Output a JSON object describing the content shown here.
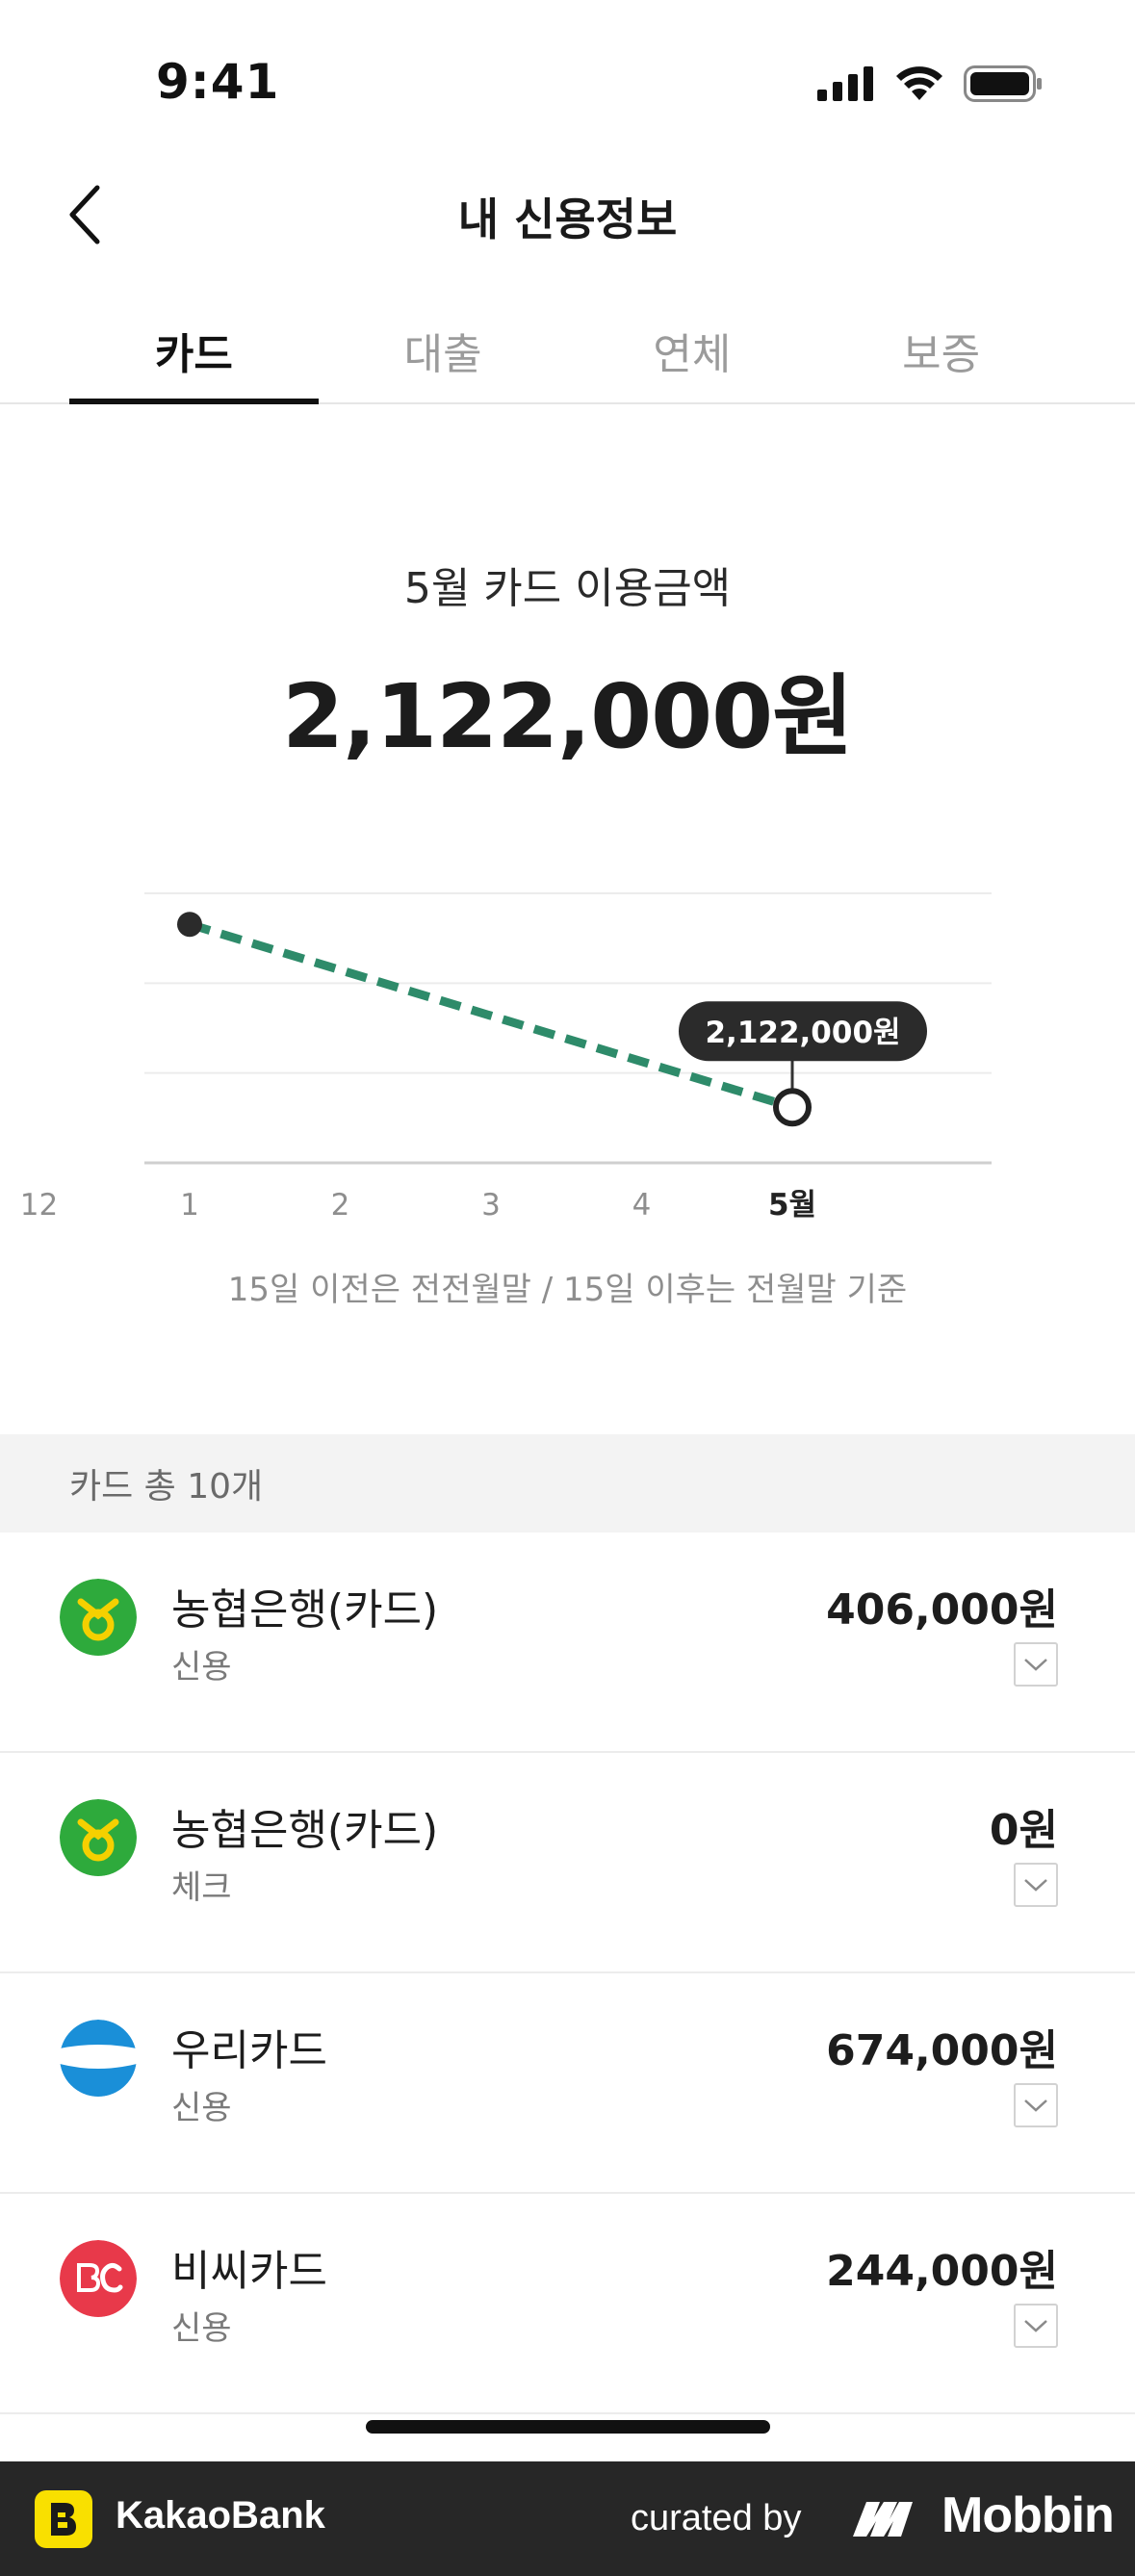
{
  "status_bar": {
    "time": "9:41"
  },
  "nav": {
    "title": "내 신용정보"
  },
  "tabs": [
    {
      "label": "카드",
      "active": true
    },
    {
      "label": "대출",
      "active": false
    },
    {
      "label": "연체",
      "active": false
    },
    {
      "label": "보증",
      "active": false
    }
  ],
  "summary": {
    "label": "5월 카드 이용금액",
    "amount": "2,122,000원"
  },
  "chart_data": {
    "type": "line",
    "categories": [
      "12",
      "1",
      "2",
      "3",
      "4",
      "5월"
    ],
    "values": [
      null,
      2900000,
      null,
      null,
      null,
      2122000
    ],
    "highlight_category": "5월",
    "highlight_label": "2,122,000원",
    "line_style": "dashed",
    "line_color": "#2e8b6a",
    "grid": true,
    "note": "15일 이전은 전전월말 / 15일 이후는 전월말 기준"
  },
  "cards_section": {
    "header": "카드 총 10개"
  },
  "cards": [
    {
      "name": "농협은행(카드)",
      "type": "신용",
      "amount": "406,000원",
      "logo": "nh-bank-logo"
    },
    {
      "name": "농협은행(카드)",
      "type": "체크",
      "amount": "0원",
      "logo": "nh-bank-logo"
    },
    {
      "name": "우리카드",
      "type": "신용",
      "amount": "674,000원",
      "logo": "woori-card-logo"
    },
    {
      "name": "비씨카드",
      "type": "신용",
      "amount": "244,000원",
      "logo": "bc-card-logo"
    }
  ],
  "footer": {
    "app_name": "KakaoBank",
    "curated_by": "curated by",
    "brand": "Mobbin"
  },
  "colors": {
    "accent_green": "#2e8b6a",
    "nh_green": "#2eaa3c",
    "woori_blue": "#1a8fd8",
    "bc_red": "#e8394a",
    "kakao_yellow": "#f9e000"
  }
}
